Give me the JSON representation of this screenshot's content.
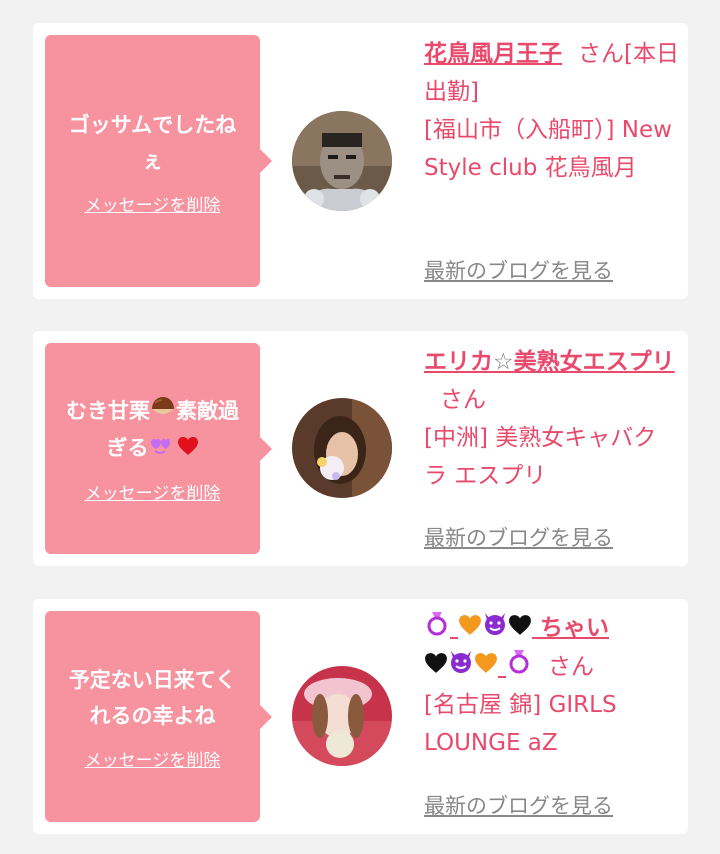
{
  "items": [
    {
      "message": "ゴッサムでしたねぇ",
      "delete_label": "メッセージを削除",
      "name": "花鳥風月王子",
      "honorific": "さん",
      "status": "[本日出勤]",
      "location": "[福山市（入船町）] New Style club 花鳥風月",
      "blog_link": "最新のブログを見る"
    },
    {
      "message_text_1": "むき甘栗",
      "message_text_2": "素敵過ぎる",
      "delete_label": "メッセージを削除",
      "name_1": "エリカ",
      "name_star": "☆",
      "name_2": "美熟女エスプリ",
      "honorific": "さん",
      "location": "[中洲] 美熟女キャバクラ エスプリ",
      "blog_link": "最新のブログを見る"
    },
    {
      "message": "予定ない日来てくれるの幸よね",
      "delete_label": "メッセージを削除",
      "name_text": "ちゃい",
      "honorific": "さん",
      "location": "[名古屋 錦] GIRLS LOUNGE aZ",
      "blog_link": "最新のブログを見る"
    }
  ],
  "colors": {
    "page_bg": "#f2f2f2",
    "bubble_pink": "#f7929f",
    "accent_pink": "#e94a6c",
    "link_gray": "#888888"
  },
  "icons": [
    "chestnut-emoji",
    "smiling-heart-eyes-emoji",
    "red-heart-emoji",
    "ring-emoji",
    "orange-heart-emoji",
    "smiling-devil-emoji",
    "black-heart-emoji"
  ]
}
